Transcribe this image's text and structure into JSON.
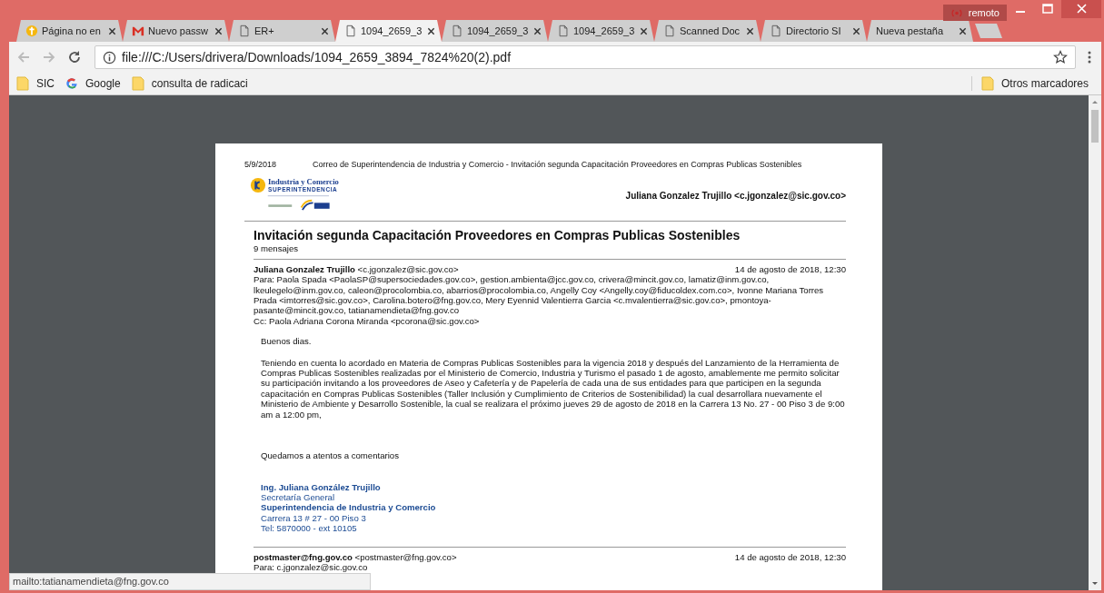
{
  "window": {
    "remote_badge": "remoto"
  },
  "tabs": [
    {
      "label": "Página no en",
      "kind": "site",
      "selected": false
    },
    {
      "label": "Nuevo passw",
      "kind": "mail",
      "selected": false
    },
    {
      "label": "ER+",
      "kind": "document",
      "selected": false
    },
    {
      "label": "1094_2659_3",
      "kind": "document",
      "selected": true
    },
    {
      "label": "1094_2659_3",
      "kind": "document",
      "selected": false
    },
    {
      "label": "1094_2659_3",
      "kind": "document",
      "selected": false
    },
    {
      "label": "Scanned Doc",
      "kind": "document",
      "selected": false
    },
    {
      "label": "Directorio SI",
      "kind": "document",
      "selected": false
    },
    {
      "label": "Nueva pestaña",
      "kind": "blank",
      "selected": false
    }
  ],
  "address_bar": {
    "url": "file:///C:/Users/drivera/Downloads/1094_2659_3894_7824%20(2).pdf"
  },
  "bookmarks": [
    {
      "label": "SIC",
      "kind": "folder"
    },
    {
      "label": "Google",
      "kind": "site"
    },
    {
      "label": "consulta de radicaci",
      "kind": "folder"
    }
  ],
  "other_bookmarks": "Otros marcadores",
  "pdf": {
    "print_date": "5/9/2018",
    "print_title": "Correo de Superintendencia de Industria y Comercio - Invitación segunda Capacitación Proveedores en Compras Publicas Sostenibles",
    "logo": {
      "line_1": "Industria y Comercio",
      "line_2": "SUPERINTENDENCIA"
    },
    "account": "Juliana Gonzalez Trujillo <c.jgonzalez@sic.gov.co>",
    "subject": "Invitación segunda Capacitación Proveedores en Compras Publicas Sostenibles",
    "message_count": "9 mensajes",
    "messages": [
      {
        "sender": "**Juliana Gonzalez Trujillo** <c.jgonzalez@sic.gov.co>",
        "date": "14 de agosto de 2018, 12:30",
        "to": "Para: Paola Spada <PaolaSP@supersociedades.gov.co>, gestion.ambienta@jcc.gov.co, crivera@mincit.gov.co, lamatiz@inm.gov.co, lkeulegelo@inm.gov.co, caleon@procolombia.co, abarrios@procolombia.co, Angelly Coy <Angelly.coy@fiducoldex.com.co>, Ivonne Mariana Torres Prada <imtorres@sic.gov.co>, Carolina.botero@fng.gov.co, Mery Eyennid Valentierra Garcia <c.mvalentierra@sic.gov.co>, pmontoya-pasante@mincit.gov.co, tatianamendieta@fng.gov.co",
        "cc": "Cc: Paola Adriana Corona Miranda <pcorona@sic.gov.co>",
        "body": [
          "Buenos dias.",
          "Teniendo en cuenta lo acordado en Materia de Compras Publicas Sostenibles para la vigencia 2018 y después del Lanzamiento de la Herramienta de Compras Publicas Sostenibles realizadas por el Ministerio de Comercio, Industria y Turismo el pasado 1 de agosto, amablemente me permito solicitar su participación invitando a los proveedores de Aseo y Cafetería y de Papelería de cada una de sus entidades para que participen en la segunda capacitación en Compras Publicas Sostenibles (Taller Inclusión y Cumplimiento de Criterios de Sostenibilidad) la cual desarrollara nuevamente el Ministerio de Ambiente y Desarrollo Sostenible, la cual se realizara el próximo jueves 29 de agosto de 2018 en la Carrera 13 No. 27 - 00 Piso 3 de 9:00 am a 12:00 pm,",
          "Quedamos a atentos a comentarios"
        ],
        "signature": [
          {
            "text": "Ing. Juliana González Trujillo",
            "bold": true
          },
          {
            "text": "Secretaría General",
            "bold": false
          },
          {
            "text": "Superintendencia de Industria y Comercio",
            "bold": true
          },
          {
            "text": "Carrera 13 # 27 - 00 Piso 3",
            "bold": false
          },
          {
            "text": "Tel: 5870000 - ext 10105",
            "bold": false
          }
        ]
      },
      {
        "sender": "**postmaster@fng.gov.co** <postmaster@fng.gov.co>",
        "date": "14 de agosto de 2018, 12:30",
        "to": "Para: c.jgonzalez@sic.gov.co"
      }
    ]
  },
  "status_bubble": "mailto:tatianamendieta@fng.gov.co"
}
